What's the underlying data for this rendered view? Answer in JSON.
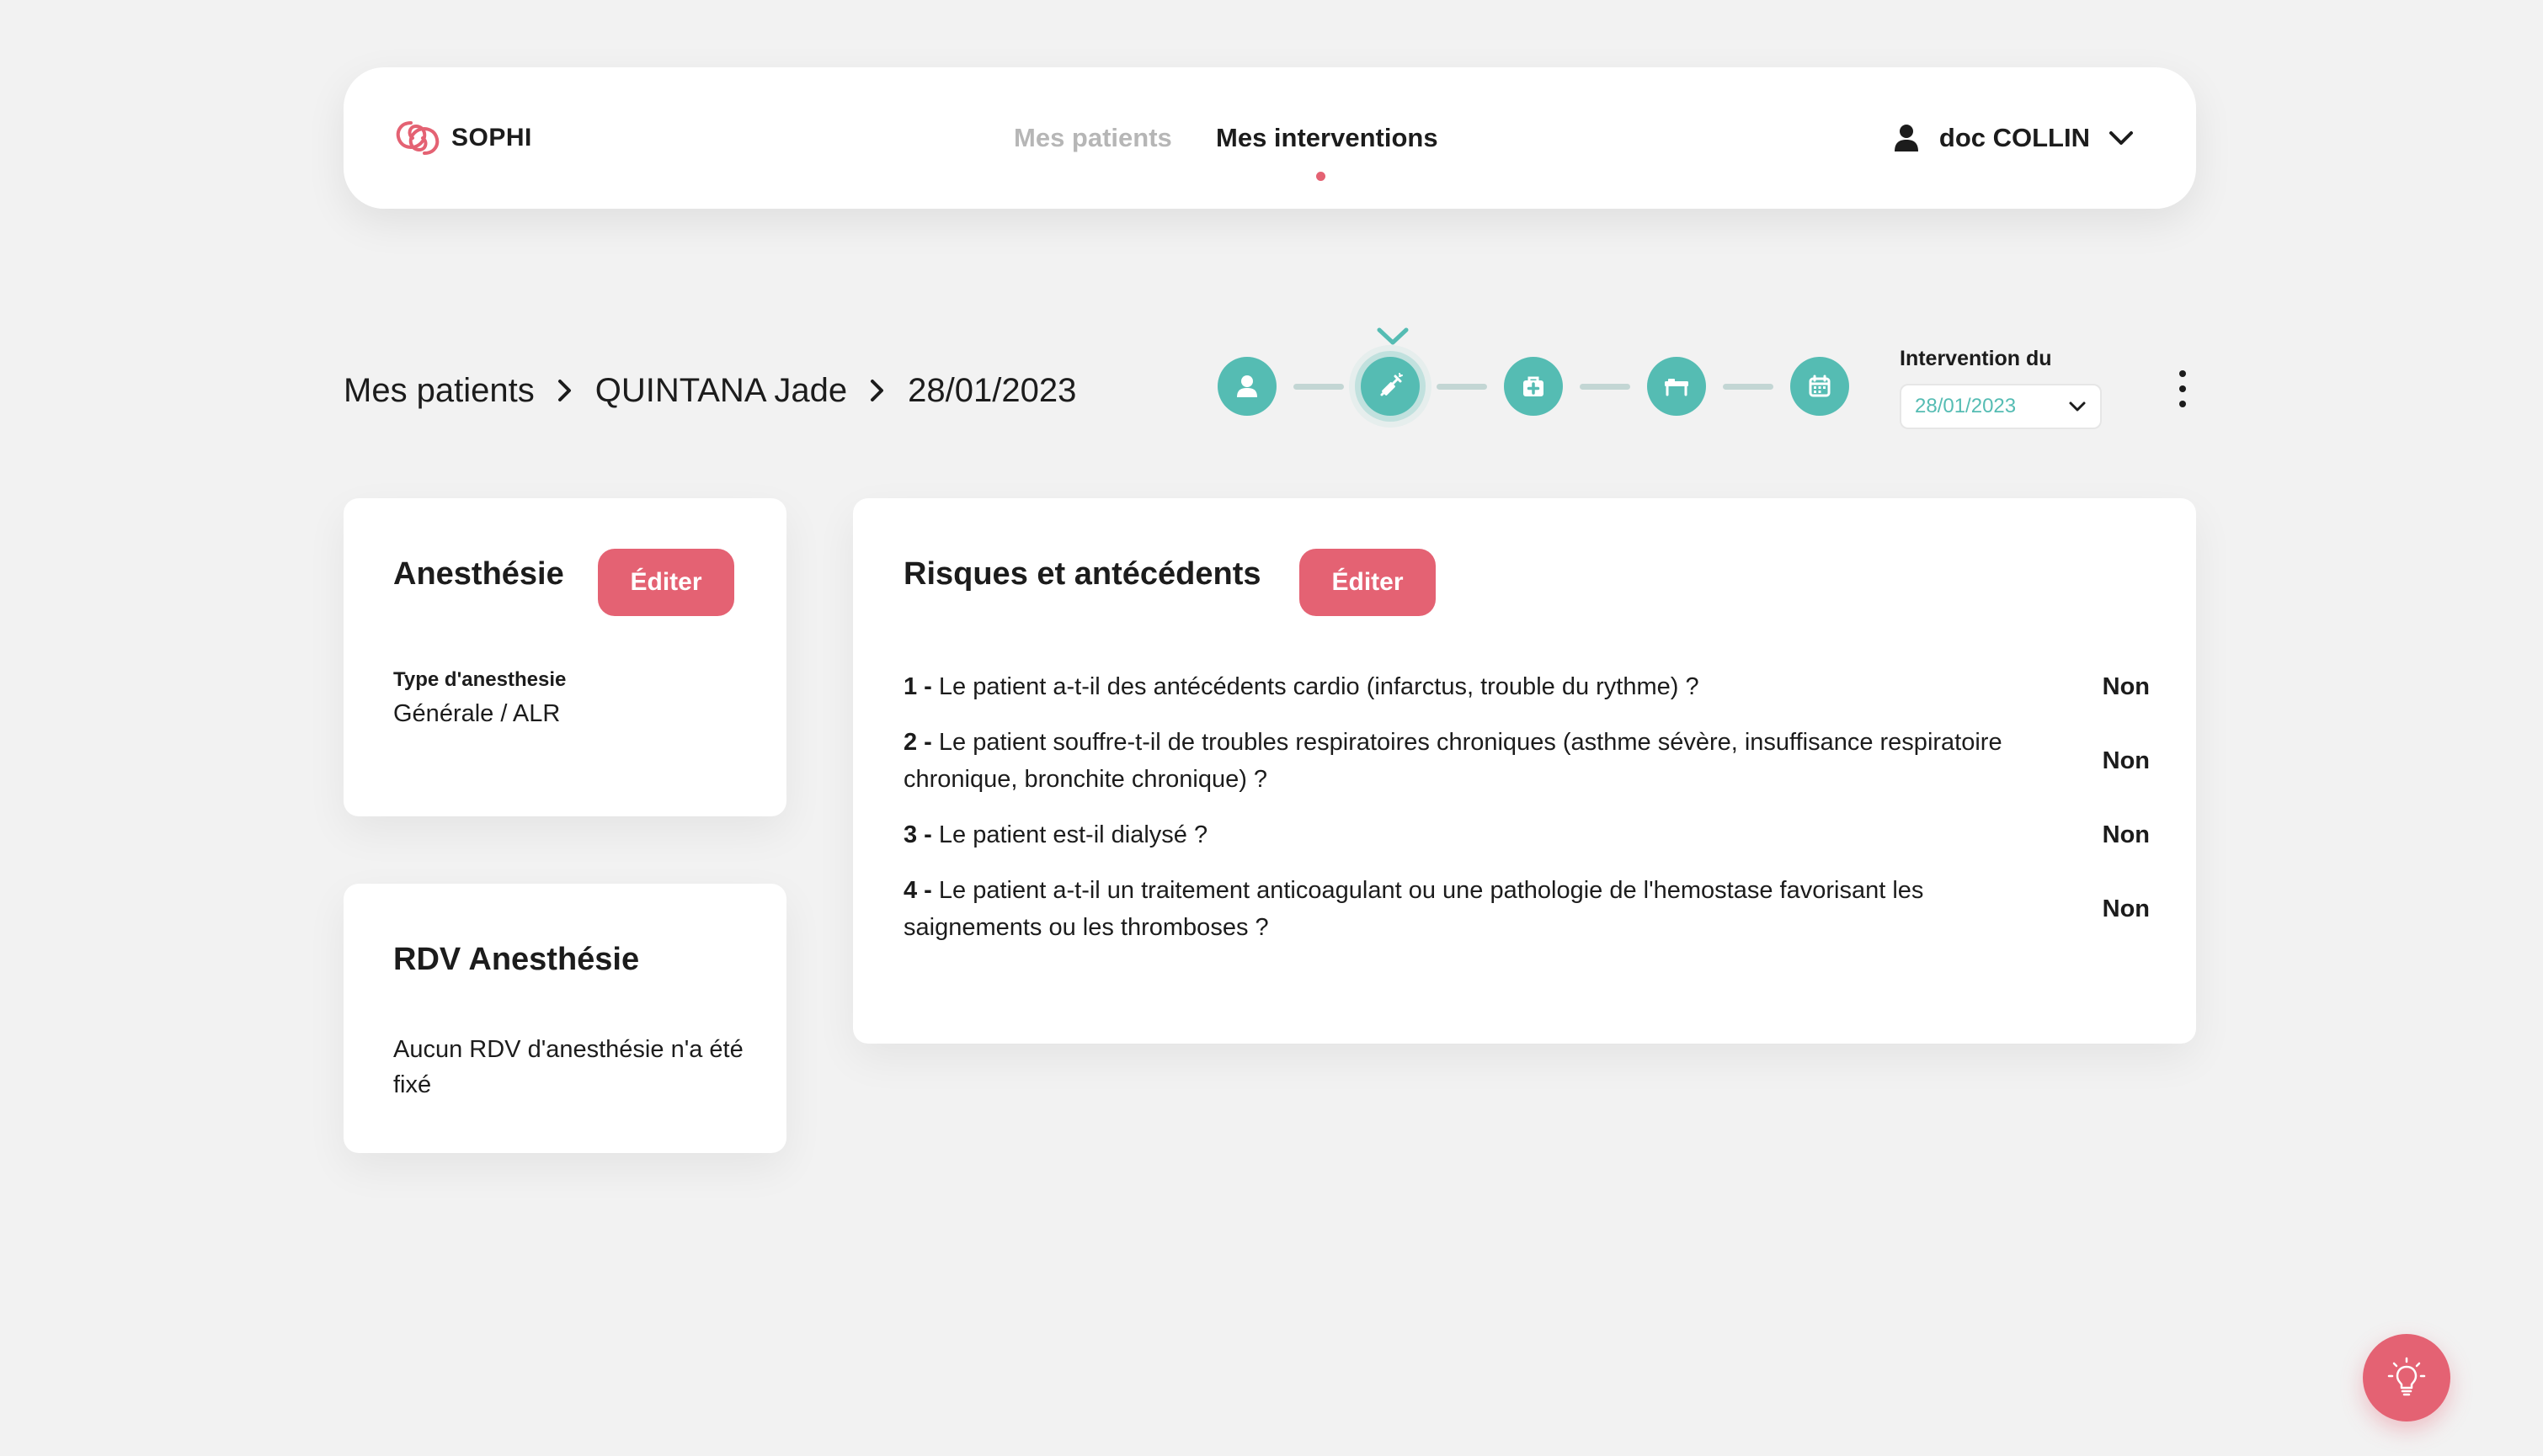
{
  "header": {
    "logo_text": "SOPHI",
    "nav": [
      {
        "label": "Mes patients",
        "active": false
      },
      {
        "label": "Mes interventions",
        "active": true
      }
    ],
    "user_name": "doc COLLIN"
  },
  "breadcrumb": [
    "Mes patients",
    "QUINTANA Jade",
    "28/01/2023"
  ],
  "stepper": {
    "steps": [
      "user-icon",
      "syringe-icon",
      "medical-kit-icon",
      "bed-icon",
      "calendar-icon"
    ],
    "current_index": 1
  },
  "intervention": {
    "label": "Intervention du",
    "selected_date": "28/01/2023"
  },
  "anesthesie_card": {
    "title": "Anesthésie",
    "edit_label": "Éditer",
    "field_label": "Type d'anesthesie",
    "field_value": "Générale / ALR"
  },
  "rdv_card": {
    "title": "RDV Anesthésie",
    "text": "Aucun RDV d'anesthésie n'a été fixé"
  },
  "risques_card": {
    "title": "Risques et antécédents",
    "edit_label": "Éditer",
    "questions": [
      {
        "num": "1 -",
        "text": "Le patient a-t-il des antécédents cardio (infarctus, trouble du rythme) ?",
        "answer": "Non"
      },
      {
        "num": "2 -",
        "text": "Le patient souffre-t-il de troubles respiratoires chroniques (asthme sévère, insuffisance respiratoire chronique, bronchite chronique) ?",
        "answer": "Non"
      },
      {
        "num": "3 -",
        "text": "Le patient est-il dialysé ?",
        "answer": "Non"
      },
      {
        "num": "4 -",
        "text": "Le patient a-t-il un traitement anticoagulant ou une pathologie de l'hemostase favorisant les saignements ou les thromboses ?",
        "answer": "Non"
      }
    ]
  },
  "colors": {
    "accent": "#e46273",
    "teal": "#55bcb3",
    "background": "#f2f2f2",
    "inactive_nav": "#b6b6b6"
  }
}
